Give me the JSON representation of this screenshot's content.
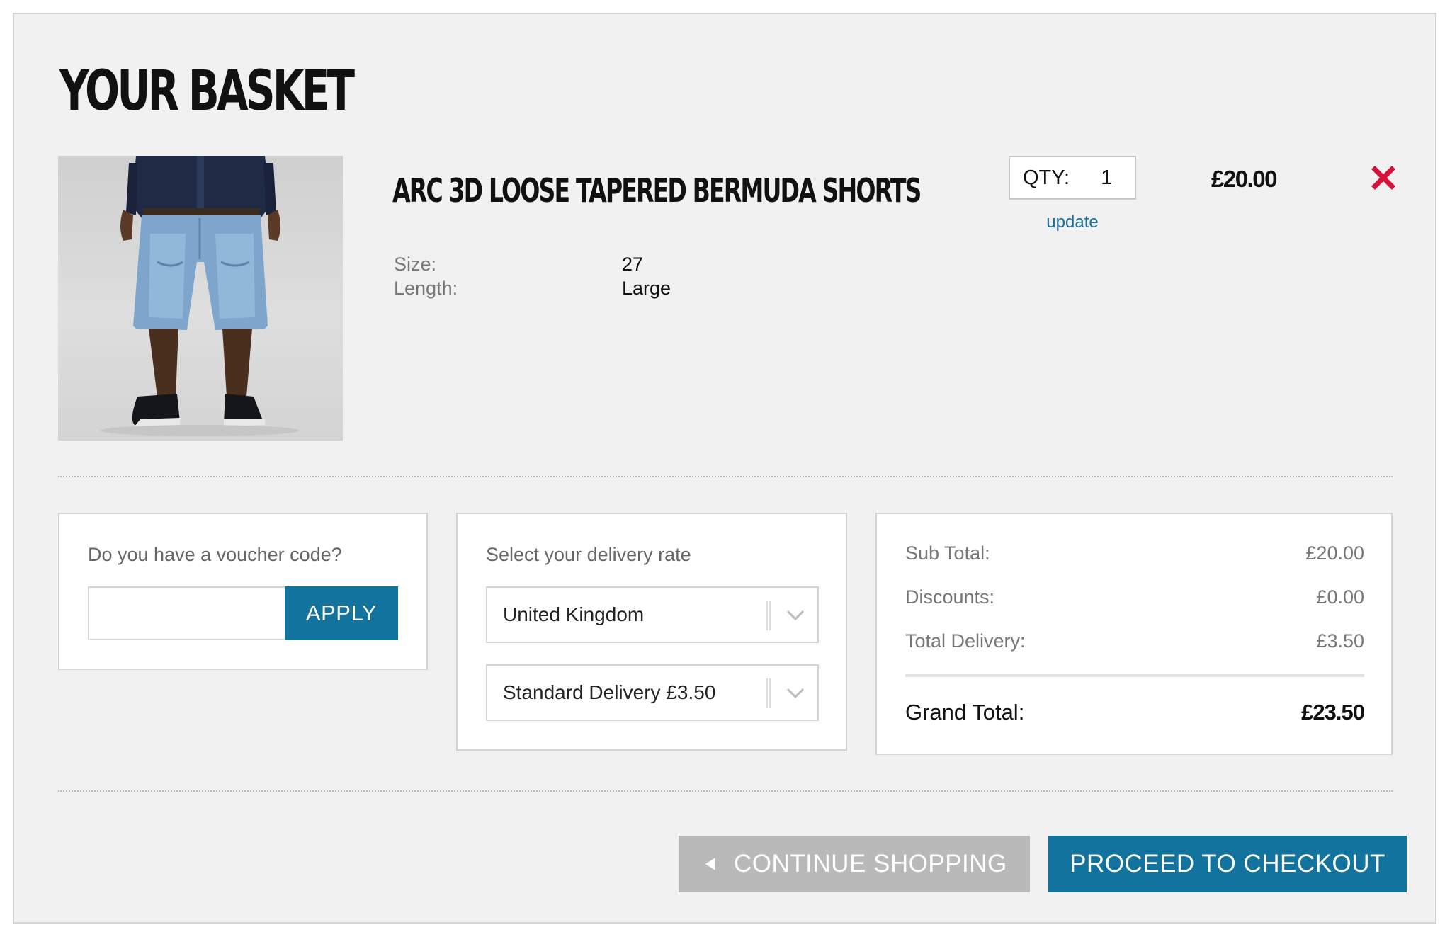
{
  "page": {
    "title": "YOUR BASKET"
  },
  "item": {
    "image_alt": "Man wearing light blue denim Bermuda shorts, dark denim shirt and black sneakers",
    "name": "ARC 3D LOOSE TAPERED BERMUDA SHORTS",
    "attributes": [
      {
        "label": "Size:",
        "value": "27"
      },
      {
        "label": "Length:",
        "value": "Large"
      }
    ],
    "qty_label": "QTY:",
    "qty_value": "1",
    "update_label": "update",
    "price": "£20.00",
    "remove_icon": "close-icon"
  },
  "voucher": {
    "heading": "Do you have a voucher code?",
    "input_value": "",
    "apply_label": "APPLY"
  },
  "delivery": {
    "heading": "Select your delivery rate",
    "country_selected": "United Kingdom",
    "rate_selected": "Standard Delivery £3.50"
  },
  "totals": {
    "rows": [
      {
        "label": "Sub Total:",
        "value": "£20.00"
      },
      {
        "label": "Discounts:",
        "value": "£0.00"
      },
      {
        "label": "Total Delivery:",
        "value": "£3.50"
      }
    ],
    "grand_label": "Grand Total:",
    "grand_value": "£23.50"
  },
  "actions": {
    "continue_label": "CONTINUE SHOPPING",
    "checkout_label": "PROCEED TO CHECKOUT"
  },
  "colors": {
    "accent": "#13739f",
    "link": "#1a6f9c",
    "remove": "#d5133a",
    "secondary_button": "#b9b9b9",
    "panel_background": "#f1f1f1"
  }
}
